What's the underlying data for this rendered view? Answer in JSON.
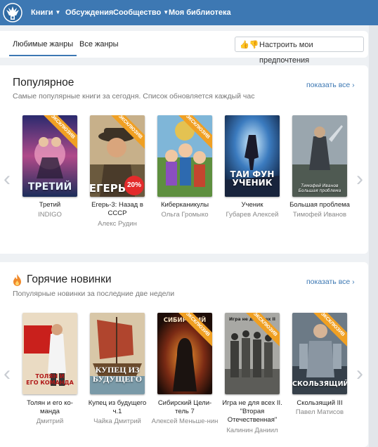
{
  "header": {
    "logo_icon": "eagle-crest-icon",
    "nav": [
      {
        "label": "Книги",
        "has_dropdown": true
      },
      {
        "label": "Обсуждения",
        "has_dropdown": false
      },
      {
        "label": "Сообщество",
        "has_dropdown": true
      },
      {
        "label": "Моя библиотека",
        "has_dropdown": false
      }
    ],
    "dropdown_glyph": "▼"
  },
  "tabs": {
    "items": [
      {
        "label": "Любимые жанры",
        "active": true
      },
      {
        "label": "Все жанры",
        "active": false
      }
    ],
    "preferences_button": {
      "icons": "👍👎",
      "label": "Настроить мои предпочтения"
    }
  },
  "sections": [
    {
      "title": "Популярное",
      "subtitle": "Самые популярные книги за сегодня. Список обновляется каждый час",
      "show_all": "показать все ›",
      "books": [
        {
          "title": "Третий",
          "author": "INDIGO",
          "cover_text": "ТРЕТИЙ",
          "badge": "ЭКСКЛЮЗИВ",
          "discount": ""
        },
        {
          "title": "Егерь-3: Назад в СССР",
          "author": "Алекс Рудин",
          "cover_text": "ЕГЕРЬ",
          "badge": "ЭКСКЛЮЗИВ",
          "discount": "20%"
        },
        {
          "title": "Киберканикулы",
          "author": "Ольга Громыко",
          "cover_text": "",
          "badge": "ЭКСКЛЮЗИВ",
          "discount": ""
        },
        {
          "title": "Ученик",
          "author": "Губарев Алексей",
          "cover_text": "ТАИ ФУН\nУЧЕНИК",
          "badge": "",
          "discount": ""
        },
        {
          "title": "Большая проблема",
          "author": "Тимофей Иванов",
          "cover_text": "Тимофей Иванов\nБольшая проблема",
          "badge": "",
          "discount": ""
        }
      ]
    },
    {
      "title": "Горячие новинки",
      "title_icon": "flame-icon",
      "subtitle": "Популярные новинки за последние две недели",
      "show_all": "показать все ›",
      "books": [
        {
          "title": "Толян и его ко-манда",
          "author": "Дмитрий",
          "cover_text": "ТОЛЯН И\nЕГО КОМАНДА",
          "badge": "",
          "discount": ""
        },
        {
          "title": "Купец из будущего ч.1",
          "author": "Чайка Дмитрий",
          "cover_text": "КУПЕЦ ИЗ\nБУДУЩЕГО",
          "badge": "",
          "discount": ""
        },
        {
          "title": "Сибирский Цели-тель 7",
          "author": "Алексей Меньше-нин",
          "cover_text": "СИБИРСКИЙ",
          "badge": "ЭКСКЛЮЗИВ",
          "discount": ""
        },
        {
          "title": "Игра не для всех II. \"Вторая Отечественная\"",
          "author": "Калинин Даниил",
          "cover_text": "Игра не для всех II",
          "badge": "ЭКСКЛЮЗИВ",
          "discount": ""
        },
        {
          "title": "Скользящий III",
          "author": "Павел Матисов",
          "cover_text": "СКОЛЬЗЯЩИЙ III",
          "badge": "ЭКСКЛЮЗИВ",
          "discount": ""
        }
      ]
    }
  ],
  "carousel_arrows": {
    "left": "‹",
    "right": "›"
  },
  "colors": {
    "brand": "#3d78b3",
    "badge": "#f0a023",
    "discount": "#e32b2b"
  }
}
